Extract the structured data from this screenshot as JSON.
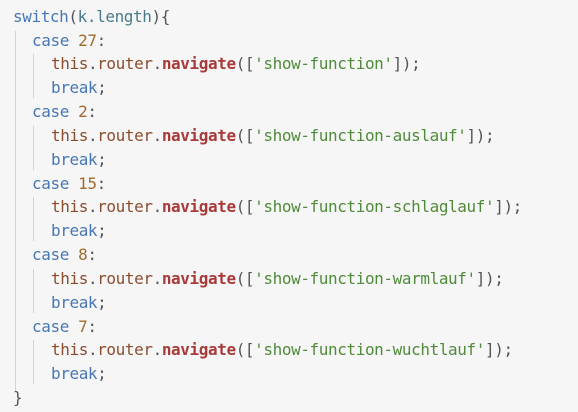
{
  "code": {
    "switch_keyword": "switch",
    "switch_open": "(",
    "switch_expr": "k.length",
    "switch_close": "){",
    "cases": [
      {
        "keyword": "case",
        "value": "27",
        "route": "'show-function'"
      },
      {
        "keyword": "case",
        "value": "2",
        "route": "'show-function-auslauf'"
      },
      {
        "keyword": "case",
        "value": "15",
        "route": "'show-function-schlaglauf'"
      },
      {
        "keyword": "case",
        "value": "8",
        "route": "'show-function-warmlauf'"
      },
      {
        "keyword": "case",
        "value": "7",
        "route": "'show-function-wuchtlauf'"
      }
    ],
    "this_keyword": "this",
    "router_prop": "router",
    "navigate_fn": "navigate",
    "break_keyword": "break",
    "closing_brace": "}"
  },
  "colors": {
    "background": "#f6f6f6",
    "keyword": "#4677b6",
    "number": "#a06b2f",
    "function": "#a83a3a",
    "string": "#4f8b3a"
  }
}
